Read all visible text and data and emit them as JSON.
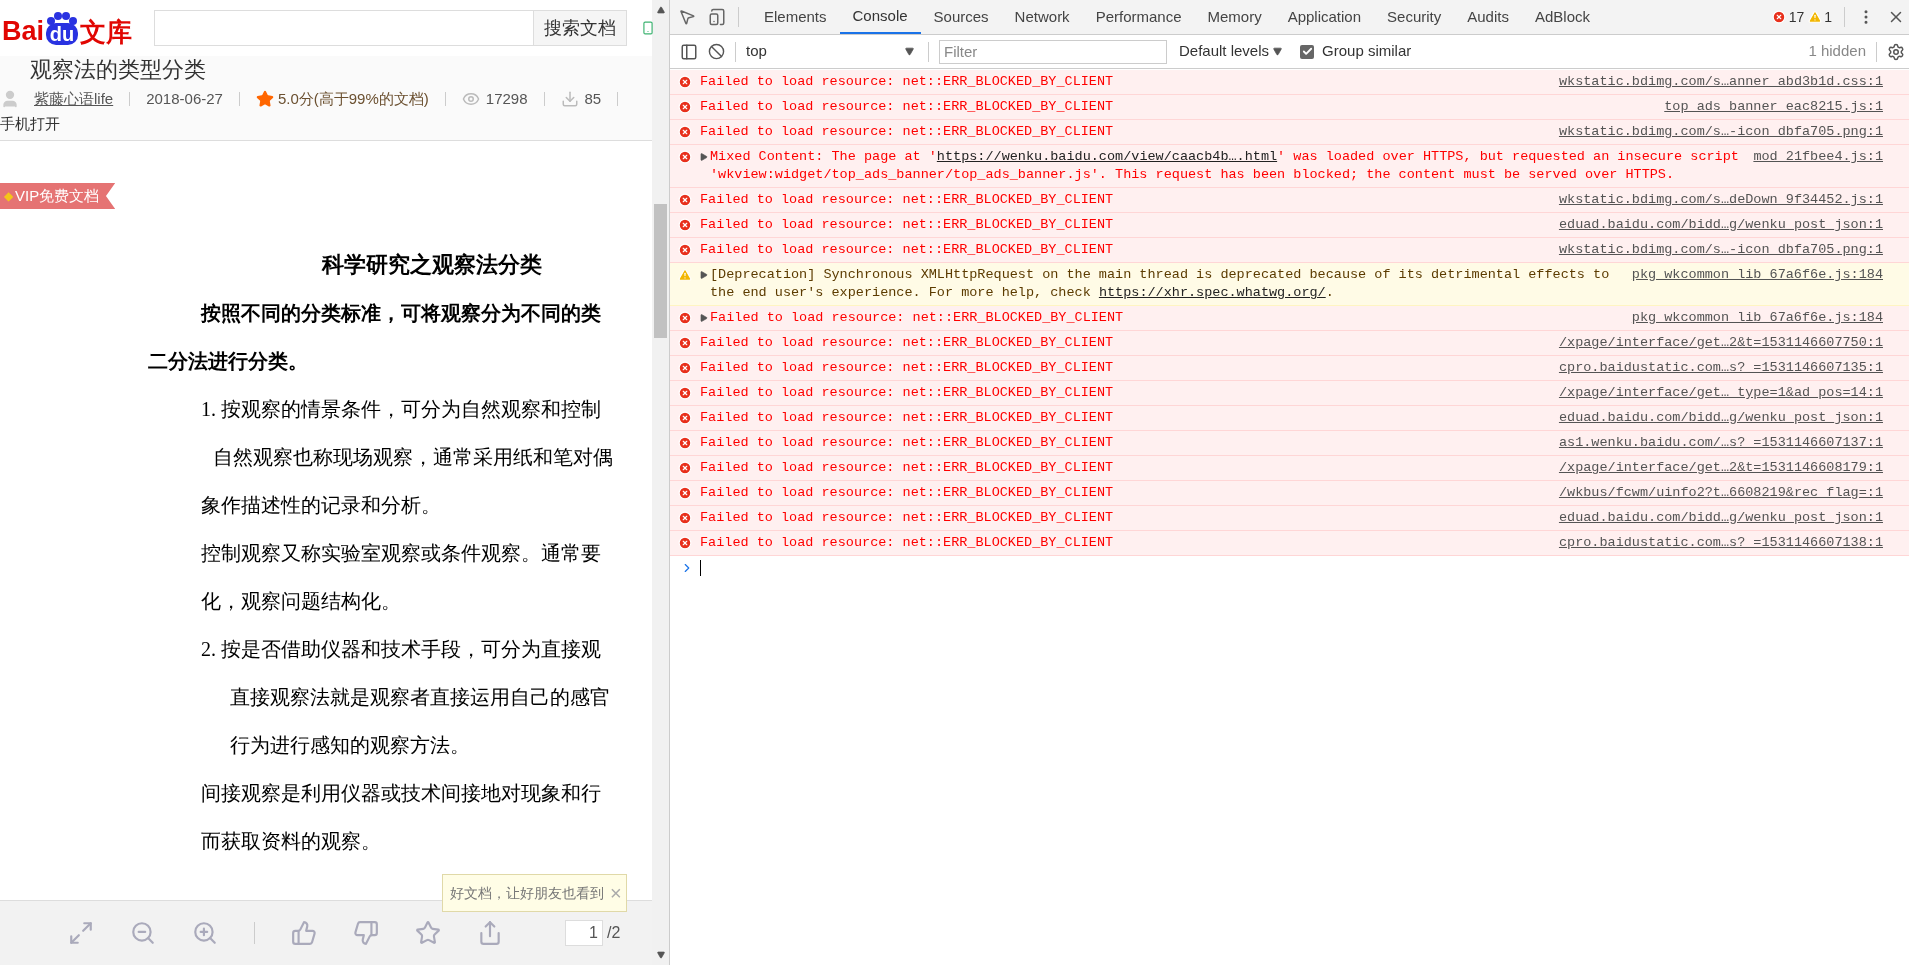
{
  "browser_page": {
    "logo": {
      "left": "Bai",
      "paw": "du",
      "right": "文库"
    },
    "search": {
      "button": "搜索文档"
    },
    "doc_heading": "观察法的类型分类",
    "meta": {
      "author": "紫藤心语life",
      "date": "2018-06-27",
      "rating": "5.0分(高于99%的文档)",
      "views": "17298",
      "downloads": "85"
    },
    "mobile_link": "手机打开",
    "vip_badge": "VIP免费文档",
    "vip_icon": "◆",
    "document": [
      {
        "kind": "title",
        "text": "科学研究之观察法分类"
      },
      {
        "kind": "lead",
        "text": "按照不同的分类标准，可将观察分为不同的类"
      },
      {
        "kind": "lead_cont",
        "text": "二分法进行分类。"
      },
      {
        "kind": "item",
        "text": "1. 按观察的情景条件，可分为自然观察和控制"
      },
      {
        "kind": "sub",
        "text": "自然观察也称现场观察，通常采用纸和笔对偶"
      },
      {
        "kind": "body",
        "text": "象作描述性的记录和分析。"
      },
      {
        "kind": "body",
        "text": "控制观察又称实验室观察或条件观察。通常要"
      },
      {
        "kind": "body",
        "text": "化，观察问题结构化。"
      },
      {
        "kind": "item",
        "text": "2. 按是否借助仪器和技术手段，可分为直接观"
      },
      {
        "kind": "sub2",
        "text": "直接观察法就是观察者直接运用自己的感官"
      },
      {
        "kind": "sub2",
        "text": "行为进行感知的观察方法。"
      },
      {
        "kind": "body",
        "text": "间接观察是利用仪器或技术间接地对现象和行"
      },
      {
        "kind": "body",
        "text": "而获取资料的观察。"
      }
    ],
    "tooltip": {
      "text": "好文档，让好朋友也看到",
      "close": "×"
    },
    "pager": {
      "page": "1",
      "total": "/2"
    }
  },
  "devtools": {
    "tabs": [
      {
        "label": "Elements",
        "selected": false
      },
      {
        "label": "Console",
        "selected": true
      },
      {
        "label": "Sources",
        "selected": false
      },
      {
        "label": "Network",
        "selected": false
      },
      {
        "label": "Performance",
        "selected": false
      },
      {
        "label": "Memory",
        "selected": false
      },
      {
        "label": "Application",
        "selected": false
      },
      {
        "label": "Security",
        "selected": false
      },
      {
        "label": "Audits",
        "selected": false
      },
      {
        "label": "AdBlock",
        "selected": false
      }
    ],
    "error_count": "17",
    "warning_count": "1",
    "context": "top",
    "filter": {
      "placeholder": "Filter"
    },
    "levels": "Default levels",
    "group_similar": {
      "label": "Group similar",
      "checked": true
    },
    "hidden": "1 hidden",
    "messages": [
      {
        "kind": "error",
        "expandable": false,
        "text": "Failed to load resource: net::ERR_BLOCKED_BY_CLIENT",
        "source": "wkstatic.bdimg.com/s…anner_abd3b1d.css:1"
      },
      {
        "kind": "error",
        "expandable": false,
        "text": "Failed to load resource: net::ERR_BLOCKED_BY_CLIENT",
        "source": "top_ads_banner_eac8215.js:1"
      },
      {
        "kind": "error",
        "expandable": false,
        "text": "Failed to load resource: net::ERR_BLOCKED_BY_CLIENT",
        "source": "wkstatic.bdimg.com/s…-icon_dbfa705.png:1"
      },
      {
        "kind": "error",
        "expandable": true,
        "text": "Mixed Content: The page at '",
        "url": "https://wenku.baidu.com/view/caacb4b….html",
        "text_after": "' was loaded over HTTPS, but requested an insecure script 'wkview:widget/top_ads_banner/top_ads_banner.js'. This request has been blocked; the content must be served over HTTPS.",
        "source": "mod_21fbee4.js:1"
      },
      {
        "kind": "error",
        "expandable": false,
        "text": "Failed to load resource: net::ERR_BLOCKED_BY_CLIENT",
        "source": "wkstatic.bdimg.com/s…deDown_9f34452.js:1"
      },
      {
        "kind": "error",
        "expandable": false,
        "text": "Failed to load resource: net::ERR_BLOCKED_BY_CLIENT",
        "source": "eduad.baidu.com/bidd…g/wenku_post_json:1"
      },
      {
        "kind": "error",
        "expandable": false,
        "text": "Failed to load resource: net::ERR_BLOCKED_BY_CLIENT",
        "source": "wkstatic.bdimg.com/s…-icon_dbfa705.png:1"
      },
      {
        "kind": "warning",
        "expandable": true,
        "text": "[Deprecation] Synchronous XMLHttpRequest on the main thread is deprecated because of its detrimental effects to the end user's experience. For more help, check ",
        "url": "https://xhr.spec.whatwg.org/",
        "text_after": ".",
        "source": "pkg_wkcommon_lib_67a6f6e.js:184"
      },
      {
        "kind": "error",
        "expandable": true,
        "text": "Failed to load resource: net::ERR_BLOCKED_BY_CLIENT",
        "source": "pkg_wkcommon_lib_67a6f6e.js:184"
      },
      {
        "kind": "error",
        "expandable": false,
        "text": "Failed to load resource: net::ERR_BLOCKED_BY_CLIENT",
        "source": "/xpage/interface/get…2&t=1531146607750:1"
      },
      {
        "kind": "error",
        "expandable": false,
        "text": "Failed to load resource: net::ERR_BLOCKED_BY_CLIENT",
        "source": "cpro.baidustatic.com…s?_=1531146607135:1"
      },
      {
        "kind": "error",
        "expandable": false,
        "text": "Failed to load resource: net::ERR_BLOCKED_BY_CLIENT",
        "source": "/xpage/interface/get…_type=1&ad_pos=14:1"
      },
      {
        "kind": "error",
        "expandable": false,
        "text": "Failed to load resource: net::ERR_BLOCKED_BY_CLIENT",
        "source": "eduad.baidu.com/bidd…g/wenku_post_json:1"
      },
      {
        "kind": "error",
        "expandable": false,
        "text": "Failed to load resource: net::ERR_BLOCKED_BY_CLIENT",
        "source": "as1.wenku.baidu.com/…s?_=1531146607137:1"
      },
      {
        "kind": "error",
        "expandable": false,
        "text": "Failed to load resource: net::ERR_BLOCKED_BY_CLIENT",
        "source": "/xpage/interface/get…2&t=1531146608179:1"
      },
      {
        "kind": "error",
        "expandable": false,
        "text": "Failed to load resource: net::ERR_BLOCKED_BY_CLIENT",
        "source": "/wkbus/fcwm/uinfo2?t…6608219&rec_flag=:1"
      },
      {
        "kind": "error",
        "expandable": false,
        "text": "Failed to load resource: net::ERR_BLOCKED_BY_CLIENT",
        "source": "eduad.baidu.com/bidd…g/wenku_post_json:1"
      },
      {
        "kind": "error",
        "expandable": false,
        "text": "Failed to load resource: net::ERR_BLOCKED_BY_CLIENT",
        "source": "cpro.baidustatic.com…s?_=1531146607138:1"
      }
    ]
  }
}
